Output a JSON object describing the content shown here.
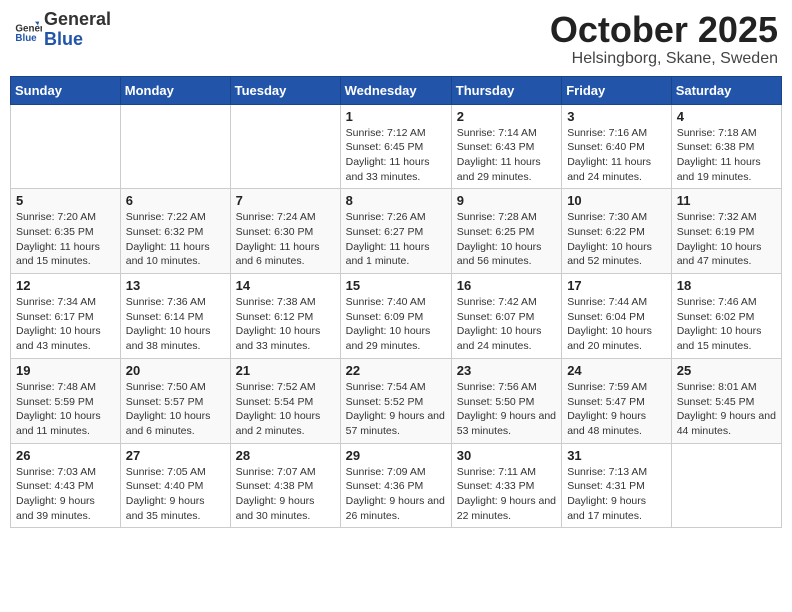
{
  "header": {
    "logo_general": "General",
    "logo_blue": "Blue",
    "month": "October 2025",
    "location": "Helsingborg, Skane, Sweden"
  },
  "weekdays": [
    "Sunday",
    "Monday",
    "Tuesday",
    "Wednesday",
    "Thursday",
    "Friday",
    "Saturday"
  ],
  "weeks": [
    [
      {
        "day": "",
        "info": ""
      },
      {
        "day": "",
        "info": ""
      },
      {
        "day": "",
        "info": ""
      },
      {
        "day": "1",
        "info": "Sunrise: 7:12 AM\nSunset: 6:45 PM\nDaylight: 11 hours and 33 minutes."
      },
      {
        "day": "2",
        "info": "Sunrise: 7:14 AM\nSunset: 6:43 PM\nDaylight: 11 hours and 29 minutes."
      },
      {
        "day": "3",
        "info": "Sunrise: 7:16 AM\nSunset: 6:40 PM\nDaylight: 11 hours and 24 minutes."
      },
      {
        "day": "4",
        "info": "Sunrise: 7:18 AM\nSunset: 6:38 PM\nDaylight: 11 hours and 19 minutes."
      }
    ],
    [
      {
        "day": "5",
        "info": "Sunrise: 7:20 AM\nSunset: 6:35 PM\nDaylight: 11 hours and 15 minutes."
      },
      {
        "day": "6",
        "info": "Sunrise: 7:22 AM\nSunset: 6:32 PM\nDaylight: 11 hours and 10 minutes."
      },
      {
        "day": "7",
        "info": "Sunrise: 7:24 AM\nSunset: 6:30 PM\nDaylight: 11 hours and 6 minutes."
      },
      {
        "day": "8",
        "info": "Sunrise: 7:26 AM\nSunset: 6:27 PM\nDaylight: 11 hours and 1 minute."
      },
      {
        "day": "9",
        "info": "Sunrise: 7:28 AM\nSunset: 6:25 PM\nDaylight: 10 hours and 56 minutes."
      },
      {
        "day": "10",
        "info": "Sunrise: 7:30 AM\nSunset: 6:22 PM\nDaylight: 10 hours and 52 minutes."
      },
      {
        "day": "11",
        "info": "Sunrise: 7:32 AM\nSunset: 6:19 PM\nDaylight: 10 hours and 47 minutes."
      }
    ],
    [
      {
        "day": "12",
        "info": "Sunrise: 7:34 AM\nSunset: 6:17 PM\nDaylight: 10 hours and 43 minutes."
      },
      {
        "day": "13",
        "info": "Sunrise: 7:36 AM\nSunset: 6:14 PM\nDaylight: 10 hours and 38 minutes."
      },
      {
        "day": "14",
        "info": "Sunrise: 7:38 AM\nSunset: 6:12 PM\nDaylight: 10 hours and 33 minutes."
      },
      {
        "day": "15",
        "info": "Sunrise: 7:40 AM\nSunset: 6:09 PM\nDaylight: 10 hours and 29 minutes."
      },
      {
        "day": "16",
        "info": "Sunrise: 7:42 AM\nSunset: 6:07 PM\nDaylight: 10 hours and 24 minutes."
      },
      {
        "day": "17",
        "info": "Sunrise: 7:44 AM\nSunset: 6:04 PM\nDaylight: 10 hours and 20 minutes."
      },
      {
        "day": "18",
        "info": "Sunrise: 7:46 AM\nSunset: 6:02 PM\nDaylight: 10 hours and 15 minutes."
      }
    ],
    [
      {
        "day": "19",
        "info": "Sunrise: 7:48 AM\nSunset: 5:59 PM\nDaylight: 10 hours and 11 minutes."
      },
      {
        "day": "20",
        "info": "Sunrise: 7:50 AM\nSunset: 5:57 PM\nDaylight: 10 hours and 6 minutes."
      },
      {
        "day": "21",
        "info": "Sunrise: 7:52 AM\nSunset: 5:54 PM\nDaylight: 10 hours and 2 minutes."
      },
      {
        "day": "22",
        "info": "Sunrise: 7:54 AM\nSunset: 5:52 PM\nDaylight: 9 hours and 57 minutes."
      },
      {
        "day": "23",
        "info": "Sunrise: 7:56 AM\nSunset: 5:50 PM\nDaylight: 9 hours and 53 minutes."
      },
      {
        "day": "24",
        "info": "Sunrise: 7:59 AM\nSunset: 5:47 PM\nDaylight: 9 hours and 48 minutes."
      },
      {
        "day": "25",
        "info": "Sunrise: 8:01 AM\nSunset: 5:45 PM\nDaylight: 9 hours and 44 minutes."
      }
    ],
    [
      {
        "day": "26",
        "info": "Sunrise: 7:03 AM\nSunset: 4:43 PM\nDaylight: 9 hours and 39 minutes."
      },
      {
        "day": "27",
        "info": "Sunrise: 7:05 AM\nSunset: 4:40 PM\nDaylight: 9 hours and 35 minutes."
      },
      {
        "day": "28",
        "info": "Sunrise: 7:07 AM\nSunset: 4:38 PM\nDaylight: 9 hours and 30 minutes."
      },
      {
        "day": "29",
        "info": "Sunrise: 7:09 AM\nSunset: 4:36 PM\nDaylight: 9 hours and 26 minutes."
      },
      {
        "day": "30",
        "info": "Sunrise: 7:11 AM\nSunset: 4:33 PM\nDaylight: 9 hours and 22 minutes."
      },
      {
        "day": "31",
        "info": "Sunrise: 7:13 AM\nSunset: 4:31 PM\nDaylight: 9 hours and 17 minutes."
      },
      {
        "day": "",
        "info": ""
      }
    ]
  ]
}
